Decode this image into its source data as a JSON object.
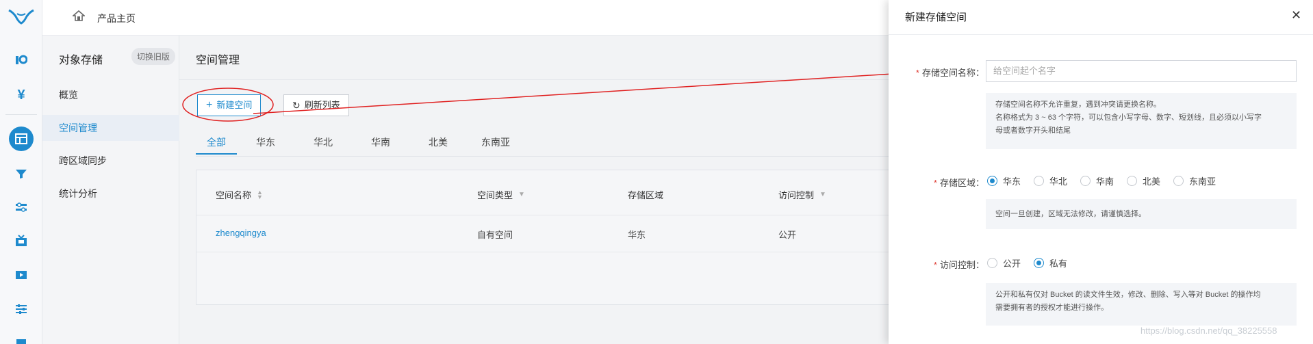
{
  "topbar": {
    "home_label": "产品主页"
  },
  "rail": {
    "icons": [
      "logo-icon",
      "data-icon",
      "yen-icon",
      "grid-icon",
      "filter-icon",
      "sliders-icon",
      "tv-icon",
      "media-icon",
      "settings-icon"
    ]
  },
  "side2": {
    "title": "对象存储",
    "switch_label": "切换旧版",
    "items": [
      {
        "label": "概览"
      },
      {
        "label": "空间管理"
      },
      {
        "label": "跨区域同步"
      },
      {
        "label": "统计分析"
      }
    ]
  },
  "main": {
    "heading": "空间管理",
    "new_button": "新建空间",
    "refresh_button": "刷新列表",
    "tabs": [
      {
        "label": "全部"
      },
      {
        "label": "华东"
      },
      {
        "label": "华北"
      },
      {
        "label": "华南"
      },
      {
        "label": "北美"
      },
      {
        "label": "东南亚"
      }
    ],
    "table": {
      "columns": [
        "空间名称",
        "空间类型",
        "存储区域",
        "访问控制"
      ],
      "rows": [
        {
          "name": "zhengqingya",
          "type": "自有空间",
          "region": "华东",
          "access": "公开"
        }
      ]
    }
  },
  "drawer": {
    "title": "新建存储空间",
    "name_label": "存储空间名称：",
    "name_placeholder": "给空间起个名字",
    "name_hint_1": "存储空间名称不允许重复，遇到冲突请更换名称。",
    "name_hint_2": "名称格式为 3 ~ 63 个字符，可以包含小写字母、数字、短划线，且必须以小写字",
    "name_hint_3": "母或者数字开头和结尾",
    "region_label": "存储区域：",
    "regions": [
      "华东",
      "华北",
      "华南",
      "北美",
      "东南亚"
    ],
    "region_selected": "华东",
    "region_hint": "空间一旦创建，区域无法修改，请谨慎选择。",
    "access_label": "访问控制：",
    "access_options": [
      "公开",
      "私有"
    ],
    "access_selected": "私有",
    "access_hint_1": "公开和私有仅对 Bucket 的读文件生效，修改、删除、写入等对 Bucket 的操作均",
    "access_hint_2": "需要拥有者的授权才能进行操作。"
  },
  "watermark": "https://blog.csdn.net/qq_38225558",
  "colors": {
    "accent": "#1e8acd",
    "required": "#e0443c",
    "annotation": "#e02020"
  }
}
